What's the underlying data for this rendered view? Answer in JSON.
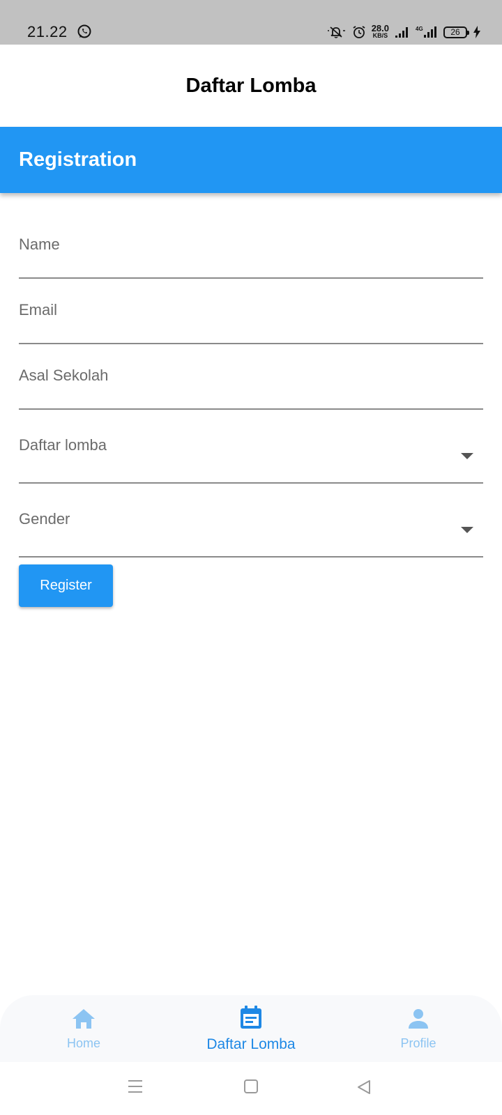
{
  "status_bar": {
    "time": "21.22",
    "net_speed_value": "28.0",
    "net_speed_unit": "KB/S",
    "network_type": "4G",
    "battery_level": "26"
  },
  "app_bar": {
    "title": "Daftar Lomba"
  },
  "registration": {
    "title": "Registration",
    "fields": [
      {
        "label": "Name",
        "value": "",
        "type": "text"
      },
      {
        "label": "Email",
        "value": "",
        "type": "text"
      },
      {
        "label": "Asal Sekolah",
        "value": "",
        "type": "text"
      },
      {
        "label": "Daftar lomba",
        "value": "",
        "type": "dropdown"
      },
      {
        "label": "Gender",
        "value": "",
        "type": "dropdown"
      }
    ],
    "register_label": "Register"
  },
  "bottom_nav": {
    "items": [
      {
        "label": "Home",
        "icon": "home-icon",
        "active": false
      },
      {
        "label": "Daftar Lomba",
        "icon": "calendar-icon",
        "active": true
      },
      {
        "label": "Profile",
        "icon": "person-icon",
        "active": false
      }
    ]
  },
  "colors": {
    "primary": "#2196f3",
    "active_nav": "#1e88e5",
    "inactive_nav": "#8cc4f2",
    "status_bar": "#c1c1c1"
  }
}
